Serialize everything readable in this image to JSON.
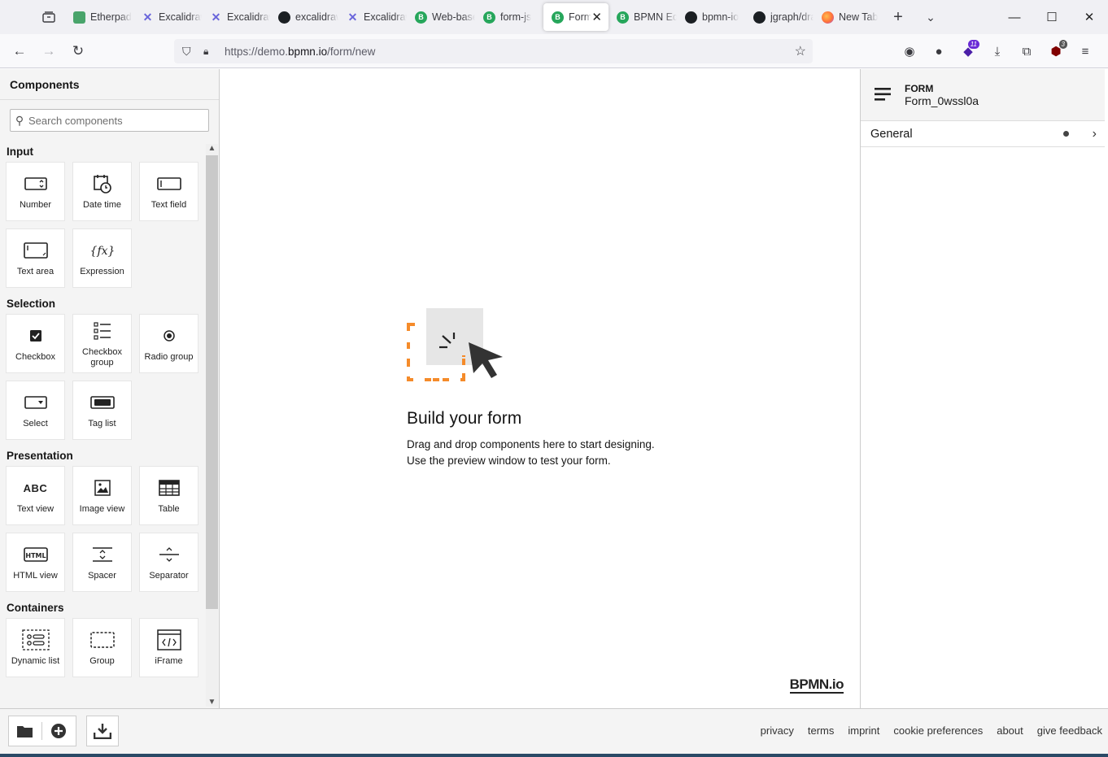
{
  "browser": {
    "tabs": [
      {
        "title": "Etherpad",
        "favicon": "etherpad-icon",
        "active": false
      },
      {
        "title": "Excalidraw",
        "favicon": "excalidraw-icon",
        "active": false
      },
      {
        "title": "Excalidraw",
        "favicon": "excalidraw-icon",
        "active": false
      },
      {
        "title": "excalidraw",
        "favicon": "github-icon",
        "active": false
      },
      {
        "title": "Excalidraw",
        "favicon": "excalidraw-icon",
        "active": false
      },
      {
        "title": "Web-based",
        "favicon": "bpmn-icon",
        "active": false
      },
      {
        "title": "form-js",
        "favicon": "bpmn-icon",
        "active": false
      },
      {
        "title": "Form",
        "favicon": "bpmn-icon",
        "active": true
      },
      {
        "title": "BPMN Editor",
        "favicon": "bpmn-icon",
        "active": false
      },
      {
        "title": "bpmn-io",
        "favicon": "github-icon",
        "active": false
      },
      {
        "title": "jgraph/drawio",
        "favicon": "github-icon",
        "active": false
      },
      {
        "title": "New Tab",
        "favicon": "firefox-icon",
        "active": false
      }
    ],
    "url_prefix": "https://demo.",
    "url_host": "bpmn.io",
    "url_path": "/form/new",
    "extension_badges": {
      "purple": "11",
      "ublock": "3"
    }
  },
  "palette": {
    "title": "Components",
    "search_placeholder": "Search components",
    "groups": [
      {
        "title": "Input",
        "items": [
          {
            "label": "Number",
            "icon": "number-icon"
          },
          {
            "label": "Date time",
            "icon": "datetime-icon"
          },
          {
            "label": "Text field",
            "icon": "textfield-icon"
          },
          {
            "label": "Text area",
            "icon": "textarea-icon"
          },
          {
            "label": "Expression",
            "icon": "expression-icon"
          }
        ]
      },
      {
        "title": "Selection",
        "items": [
          {
            "label": "Checkbox",
            "icon": "checkbox-icon"
          },
          {
            "label": "Checkbox group",
            "icon": "checkbox-group-icon"
          },
          {
            "label": "Radio group",
            "icon": "radio-group-icon"
          },
          {
            "label": "Select",
            "icon": "select-icon"
          },
          {
            "label": "Tag list",
            "icon": "taglist-icon"
          }
        ]
      },
      {
        "title": "Presentation",
        "items": [
          {
            "label": "Text view",
            "icon": "textview-icon"
          },
          {
            "label": "Image view",
            "icon": "imageview-icon"
          },
          {
            "label": "Table",
            "icon": "table-icon"
          },
          {
            "label": "HTML view",
            "icon": "htmlview-icon"
          },
          {
            "label": "Spacer",
            "icon": "spacer-icon"
          },
          {
            "label": "Separator",
            "icon": "separator-icon"
          }
        ]
      },
      {
        "title": "Containers",
        "items": [
          {
            "label": "Dynamic list",
            "icon": "dynamic-list-icon"
          },
          {
            "label": "Group",
            "icon": "group-icon"
          },
          {
            "label": "iFrame",
            "icon": "iframe-icon"
          }
        ]
      }
    ]
  },
  "canvas": {
    "empty_title": "Build your form",
    "empty_line1": "Drag and drop components here to start designing.",
    "empty_line2": "Use the preview window to test your form.",
    "brand": "BPMN.io"
  },
  "properties": {
    "type_label": "FORM",
    "form_id": "Form_0wssl0a",
    "section": "General"
  },
  "footer": {
    "links": [
      "privacy",
      "terms",
      "imprint",
      "cookie preferences",
      "about",
      "give feedback"
    ]
  },
  "colors": {
    "accent_orange": "#f58b2a",
    "bpmn_green": "#26a65b"
  }
}
